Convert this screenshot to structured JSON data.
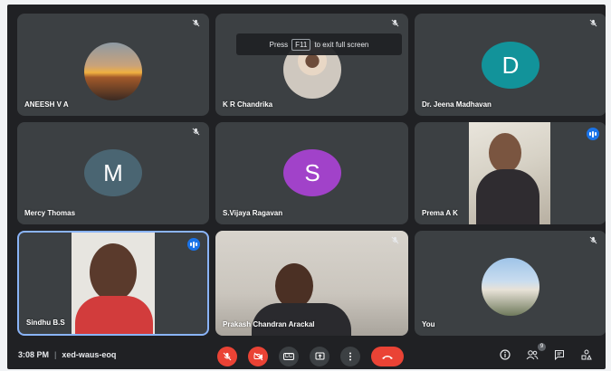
{
  "banner": {
    "press": "Press",
    "key": "F11",
    "suffix": "to exit full screen"
  },
  "participants": {
    "aneesh": {
      "name": "ANEESH V A"
    },
    "chandrika": {
      "name": "K R Chandrika"
    },
    "jeena": {
      "name": "Dr. Jeena Madhavan",
      "initial": "D",
      "color": "#12939a"
    },
    "mercy": {
      "name": "Mercy Thomas",
      "initial": "M",
      "color": "#4a6572"
    },
    "vijaya": {
      "name": "S.Vijaya Ragavan",
      "initial": "S",
      "color": "#a142c9"
    },
    "prema": {
      "name": "Prema A K"
    },
    "sindhu": {
      "name": "Sindhu B.S"
    },
    "prakash": {
      "name": "Prakash Chandran Arackal"
    },
    "you": {
      "name": "You"
    }
  },
  "meeting": {
    "time": "3:08 PM",
    "code": "xed-waus-eoq"
  },
  "controls": {
    "captions_label": "CC"
  },
  "people_count": "9",
  "colors": {
    "accent": "#1a73e8",
    "danger": "#ea4335",
    "tile": "#3c4043",
    "background": "#202124"
  },
  "icons": {
    "tile_mute": "mic-off-icon",
    "speaking": "audio-level-icon",
    "mic": "mic-off-icon",
    "camera": "camera-off-icon",
    "captions": "captions-icon",
    "present": "present-icon",
    "more": "more-vert-icon",
    "hangup": "phone-hangup-icon",
    "info": "info-icon",
    "people": "people-icon",
    "chat": "chat-icon",
    "activities": "activities-icon"
  }
}
